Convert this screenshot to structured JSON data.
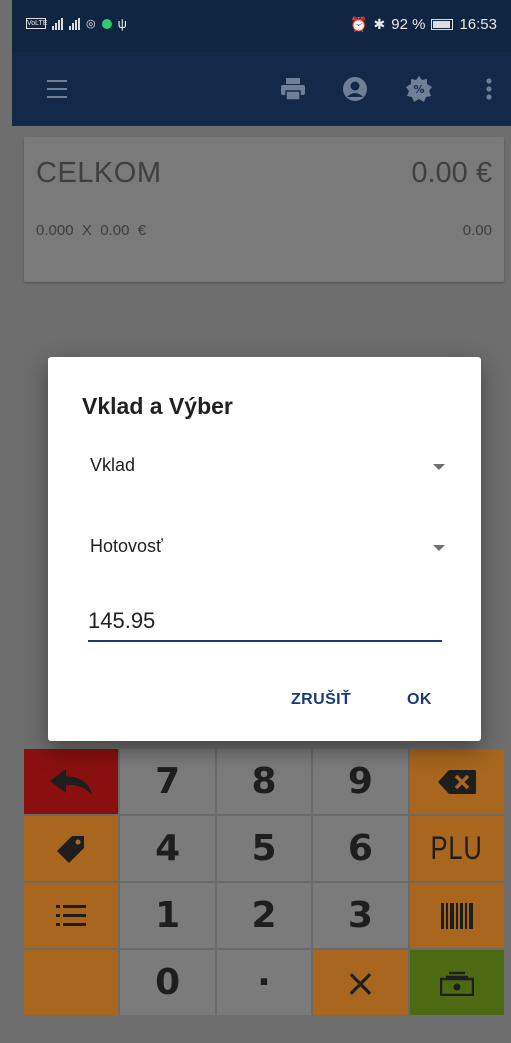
{
  "status_bar": {
    "volte": "VoLTE",
    "alarm_icon": "alarm-icon",
    "bluetooth_icon": "bluetooth-icon",
    "battery_percent": "92 %",
    "time": "16:53"
  },
  "app_bar": {
    "icons": [
      "menu-icon",
      "print-icon",
      "user-icon",
      "discount-icon",
      "more-vert-icon"
    ]
  },
  "total": {
    "label": "CELKOM",
    "amount": "0.00 €",
    "line": "0.000  X  0.00  €",
    "line_total": "0.00"
  },
  "dialog": {
    "title": "Vklad a Výber",
    "type_value": "Vklad",
    "method_value": "Hotovosť",
    "amount_value": "145.95",
    "cancel_label": "ZRUŠIŤ",
    "ok_label": "OK"
  },
  "keypad": {
    "k7": "7",
    "k8": "8",
    "k9": "9",
    "k4": "4",
    "k5": "5",
    "k6": "6",
    "k1": "1",
    "k2": "2",
    "k3": "3",
    "k0": "0",
    "dot": "·",
    "plu": "PLU",
    "times": "×"
  },
  "colors": {
    "app_bar": "#13294a",
    "accent": "#1b3a7a",
    "key_red": "#8a1010",
    "key_orange": "#a8661e",
    "key_green": "#4b6a12",
    "key_gray": "#7b7b7b"
  }
}
